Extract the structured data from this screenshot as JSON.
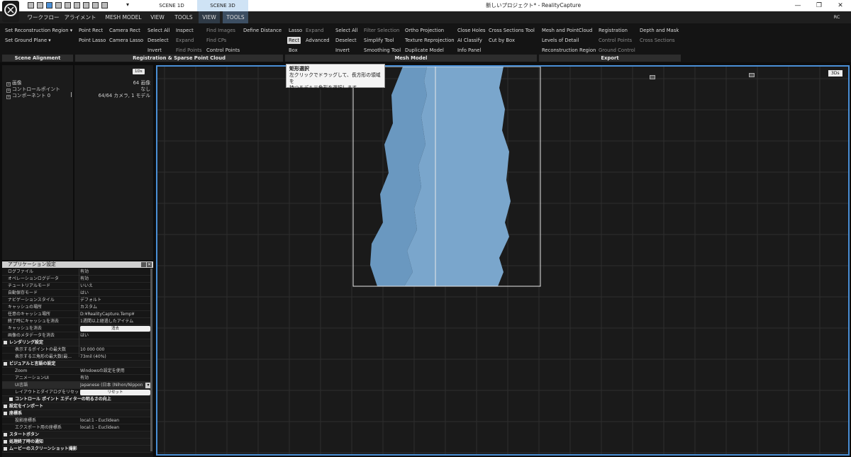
{
  "titlebar": {
    "scene_tabs": [
      "SCENE 1D",
      "SCENE 3D"
    ],
    "title": "新しいプロジェクト* - RealityCapture",
    "controls": [
      "—",
      "❐",
      "✕"
    ]
  },
  "menubar": {
    "tabs": [
      "ワークフロー",
      "アライメント",
      "MESH MODEL",
      "VIEW",
      "TOOLS",
      "VIEW",
      "TOOLS"
    ],
    "right_label": "RC"
  },
  "ribbon": {
    "scene_alignment": {
      "label": "Scene Alignment",
      "items": [
        "Set Reconstruction Region ▾",
        "Set Ground Plane ▾"
      ]
    },
    "registration": {
      "label": "Registration & Sparse Point Cloud",
      "col1": [
        "Point Rect",
        "Point Lasso"
      ],
      "col2": [
        "Camera Rect",
        "Camera Lasso"
      ],
      "col3": [
        "Select All",
        "Deselect",
        "Invert"
      ],
      "col4": [
        "Inspect",
        "Expand",
        "Find Points"
      ],
      "col5": [
        "Find Images",
        "Find CPs",
        "Control Points"
      ],
      "col6": [
        "Define Distance"
      ]
    },
    "mesh_model": {
      "label": "Mesh Model",
      "col1": [
        "Lasso",
        "Rect",
        "Box"
      ],
      "col2": [
        "Expand",
        "Advanced"
      ],
      "col3": [
        "Select All",
        "Deselect",
        "Invert"
      ],
      "col4": [
        "Filter Selection",
        "Simplify Tool",
        "Smoothing Tool"
      ],
      "col5": [
        "Ortho Projection",
        "Texture Reprojection",
        "Duplicate Model"
      ],
      "col6": [
        "Close Holes",
        "AI Classify",
        "Info Panel"
      ],
      "col7": [
        "Cross Sections Tool",
        "Cut by Box"
      ]
    },
    "export": {
      "label": "Export",
      "col1": [
        "Mesh and PointCloud",
        "Levels of Detail",
        "Reconstruction Region"
      ],
      "col2": [
        "Registration",
        "Control Points",
        "Ground Control"
      ],
      "col3": [
        "Depth and Mask",
        "Cross Sections"
      ]
    }
  },
  "leftTree": {
    "chip": "1Ds",
    "items": [
      {
        "label": "画像",
        "value": "64 画像"
      },
      {
        "label": "コントロールポイント",
        "value": "なし"
      },
      {
        "label": "コンポーネント 0",
        "value": "64/64 カメラ, 1 モデル"
      }
    ]
  },
  "settings": {
    "title": "アプリケーション設定",
    "rows": [
      {
        "k": "ログファイル",
        "v": "有効",
        "t": "row"
      },
      {
        "k": "オペレーションログデータ",
        "v": "有効",
        "t": "row"
      },
      {
        "k": "チュートリアルモード",
        "v": "いいえ",
        "t": "row"
      },
      {
        "k": "自動保存モード",
        "v": "はい",
        "t": "row"
      },
      {
        "k": "ナビゲーションスタイル",
        "v": "デフォルト",
        "t": "row"
      },
      {
        "k": "キャッシュの場所",
        "v": "カスタム",
        "t": "row"
      },
      {
        "k": "任意のキャッシュ場所",
        "v": "D:¥RealityCapture.Temp¥",
        "t": "row"
      },
      {
        "k": "終了時にキャッシュを消去",
        "v": "1週間以上経過したアイテム",
        "t": "row"
      },
      {
        "k": "キャッシュを消去",
        "v": "消去",
        "t": "btn"
      },
      {
        "k": "画像のメタデータを消去",
        "v": "はい",
        "t": "row"
      },
      {
        "k": "レンダリング設定",
        "v": "",
        "t": "sec"
      },
      {
        "k": "表示するポイントの最大数",
        "v": "10 000 000",
        "t": "sub"
      },
      {
        "k": "表示する三角形の最大数(最...",
        "v": "73mil (40%)",
        "t": "sub"
      },
      {
        "k": "ビジュアルと言語の設定",
        "v": "",
        "t": "sec"
      },
      {
        "k": "Zoom",
        "v": "Windowsの設定を使用",
        "t": "sub"
      },
      {
        "k": "アニメーションUI",
        "v": "有効",
        "t": "sub"
      },
      {
        "k": "UI言語",
        "v": "Japanese (日本 (Nihon/Nippon",
        "t": "sel"
      },
      {
        "k": "レイアウトとダイアログをリセット",
        "v": "リセット",
        "t": "subbtn"
      },
      {
        "k": "コントロール ポイント エディターの明るさの向上",
        "v": "",
        "t": "sec2"
      },
      {
        "k": "設定をインポート",
        "v": "",
        "t": "sec"
      },
      {
        "k": "座標系",
        "v": "",
        "t": "sec"
      },
      {
        "k": "投影座標系",
        "v": "local:1 - Euclidean",
        "t": "sub"
      },
      {
        "k": "エクスポート用の座標系",
        "v": "local:1 - Euclidean",
        "t": "sub"
      },
      {
        "k": "スタートボタン",
        "v": "",
        "t": "sec"
      },
      {
        "k": "処理終了時の通知",
        "v": "",
        "t": "sec"
      },
      {
        "k": "ムービーのスクリーンショット撮影",
        "v": "",
        "t": "sec"
      }
    ]
  },
  "viewport": {
    "chip": "3Ds",
    "tooltip_title": "矩形選択",
    "tooltip_line1": "左クリックでドラッグして、長方形の領域を",
    "tooltip_line2": "持つモデル三角形を選択します"
  },
  "colors": {
    "accent": "#4a8fd6",
    "mesh": "#7aa6cc",
    "bg": "#1a1a1a"
  }
}
